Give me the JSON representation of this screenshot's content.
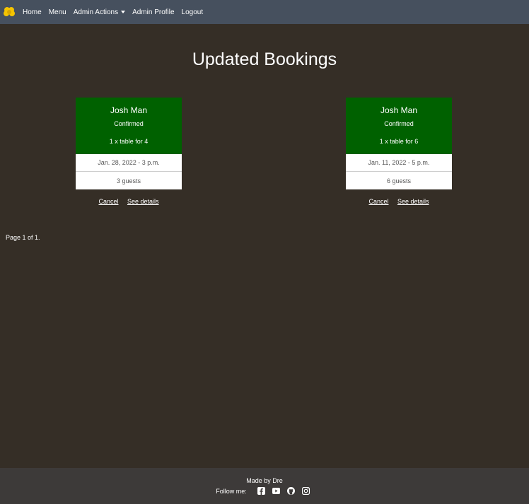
{
  "nav": {
    "items": [
      {
        "label": "Home"
      },
      {
        "label": "Menu"
      },
      {
        "label": "Admin Actions"
      },
      {
        "label": "Admin Profile"
      },
      {
        "label": "Logout"
      }
    ]
  },
  "page": {
    "title": "Updated Bookings",
    "pagination": "Page 1 of 1."
  },
  "bookings": [
    {
      "name": "Josh Man",
      "status": "Confirmed",
      "table": "1 x table for 4",
      "datetime": "Jan. 28, 2022 - 3 p.m.",
      "guests": "3 guests",
      "cancel_label": "Cancel",
      "details_label": "See details"
    },
    {
      "name": "Josh Man",
      "status": "Confirmed",
      "table": "1 x table for 6",
      "datetime": "Jan. 11, 2022 - 5 p.m.",
      "guests": "6 guests",
      "cancel_label": "Cancel",
      "details_label": "See details"
    }
  ],
  "footer": {
    "credit": "Made by Dre",
    "follow_label": "Follow me:",
    "icons": [
      "facebook-icon",
      "youtube-icon",
      "github-icon",
      "instagram-icon"
    ]
  },
  "colors": {
    "background": "#352e26",
    "navbar": "#46505e",
    "card_header": "#006100",
    "footer": "#3d3a39",
    "logo": "#f5c400"
  }
}
